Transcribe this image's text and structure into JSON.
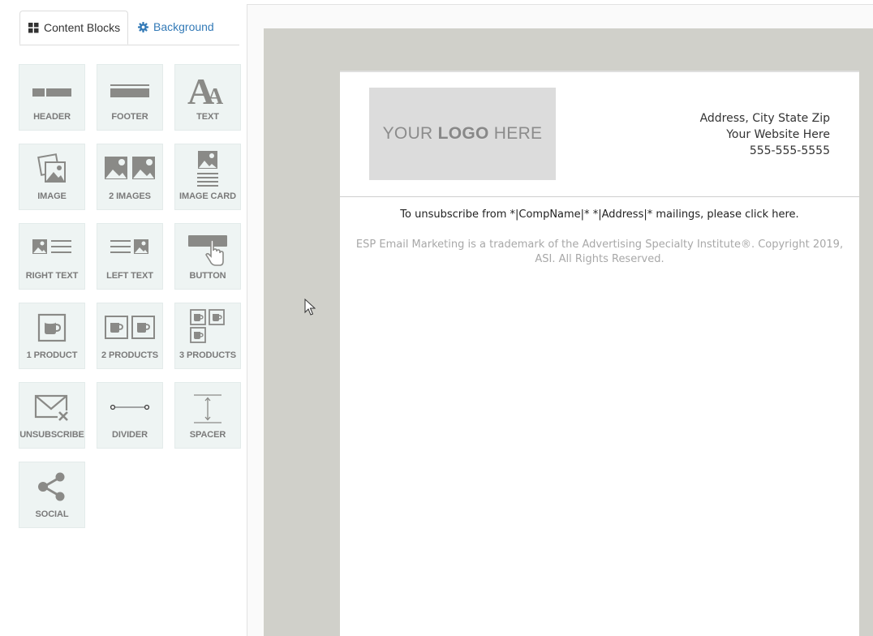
{
  "tabs": {
    "content_blocks": "Content Blocks",
    "background": "Background"
  },
  "blocks": [
    {
      "label": "HEADER",
      "icon": "header-icon"
    },
    {
      "label": "FOOTER",
      "icon": "footer-icon"
    },
    {
      "label": "TEXT",
      "icon": "text-icon"
    },
    {
      "label": "IMAGE",
      "icon": "image-icon"
    },
    {
      "label": "2 IMAGES",
      "icon": "two-images-icon"
    },
    {
      "label": "IMAGE CARD",
      "icon": "image-card-icon"
    },
    {
      "label": "RIGHT TEXT",
      "icon": "right-text-icon"
    },
    {
      "label": "LEFT TEXT",
      "icon": "left-text-icon"
    },
    {
      "label": "BUTTON",
      "icon": "button-icon"
    },
    {
      "label": "1 PRODUCT",
      "icon": "one-product-icon"
    },
    {
      "label": "2 PRODUCTS",
      "icon": "two-products-icon"
    },
    {
      "label": "3 PRODUCTS",
      "icon": "three-products-icon"
    },
    {
      "label": "UNSUBSCRIBE",
      "icon": "unsubscribe-icon"
    },
    {
      "label": "DIVIDER",
      "icon": "divider-icon"
    },
    {
      "label": "SPACER",
      "icon": "spacer-icon"
    },
    {
      "label": "SOCIAL",
      "icon": "share-icon"
    }
  ],
  "email": {
    "logo": {
      "prefix": "YOUR ",
      "bold": "LOGO",
      "suffix": " HERE"
    },
    "address": "Address, City State Zip",
    "website": "Your Website Here",
    "phone": "555-555-5555",
    "unsubscribe_text": "To unsubscribe from *|CompName|* *|Address|* mailings, please click here.",
    "trademark_text": "ESP Email Marketing is a trademark of the Advertising Specialty Institute®. Copyright 2019, ASI. All Rights Reserved."
  },
  "colors": {
    "link": "#337ab7",
    "block_bg": "#eef4f3",
    "icon_gray": "#8a8a87",
    "canvas_bg": "#d0d0ca"
  }
}
